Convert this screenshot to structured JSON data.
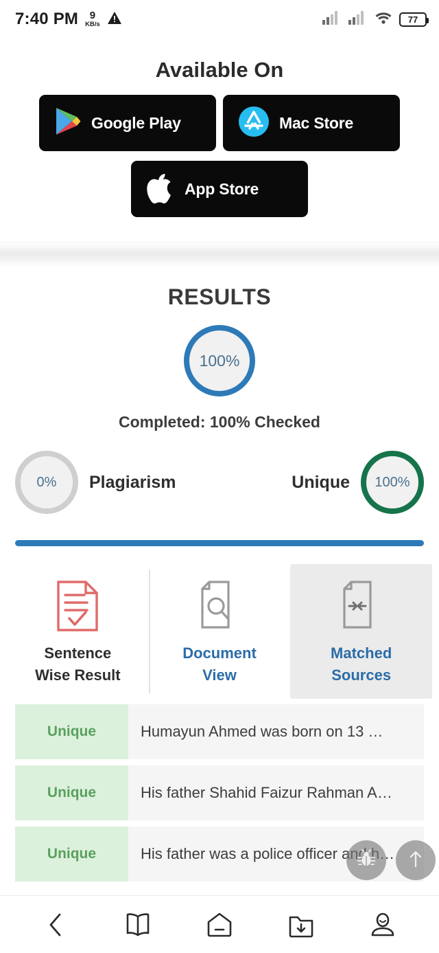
{
  "statusbar": {
    "time": "7:40 PM",
    "network_speed": "9",
    "network_unit": "KB/s",
    "warning_icon": "warning-triangle-icon",
    "signal_icon": "signal-bars-icon",
    "wifi_icon": "wifi-icon",
    "battery_level": "77"
  },
  "available": {
    "title": "Available On",
    "badges": [
      {
        "label": "Google Play",
        "icon": "google-play-icon"
      },
      {
        "label": "Mac Store",
        "icon": "mac-store-icon"
      },
      {
        "label": "App Store",
        "icon": "apple-logo-icon"
      }
    ]
  },
  "results": {
    "title": "RESULTS",
    "main_percent": "100%",
    "completed_text": "Completed: 100% Checked",
    "plagiarism": {
      "percent": "0%",
      "label": "Plagiarism",
      "color": "#cfcfcf"
    },
    "unique": {
      "percent": "100%",
      "label": "Unique",
      "color": "#16744a"
    },
    "accent_color": "#2e7ab8"
  },
  "tabs": [
    {
      "label_line1": "Sentence",
      "label_line2": "Wise Result",
      "icon": "document-check-icon",
      "active": false,
      "style": "dark"
    },
    {
      "label_line1": "Document",
      "label_line2": "View",
      "icon": "document-search-icon",
      "active": false,
      "style": "blue"
    },
    {
      "label_line1": "Matched",
      "label_line2": "Sources",
      "icon": "document-match-icon",
      "active": true,
      "style": "blue"
    }
  ],
  "rows": [
    {
      "status": "Unique",
      "text": "Humayun Ahmed was born on 13 …"
    },
    {
      "status": "Unique",
      "text": "His father Shahid Faizur Rahman A…"
    },
    {
      "status": "Unique",
      "text": "His father was a police officer and h…"
    }
  ],
  "fabs": [
    {
      "icon": "bug-icon"
    },
    {
      "icon": "scroll-to-top-arrow-icon"
    }
  ],
  "bottomnav": [
    {
      "icon": "back-chevron-icon"
    },
    {
      "icon": "book-icon"
    },
    {
      "icon": "home-icon"
    },
    {
      "icon": "download-folder-icon"
    },
    {
      "icon": "profile-person-icon"
    }
  ]
}
